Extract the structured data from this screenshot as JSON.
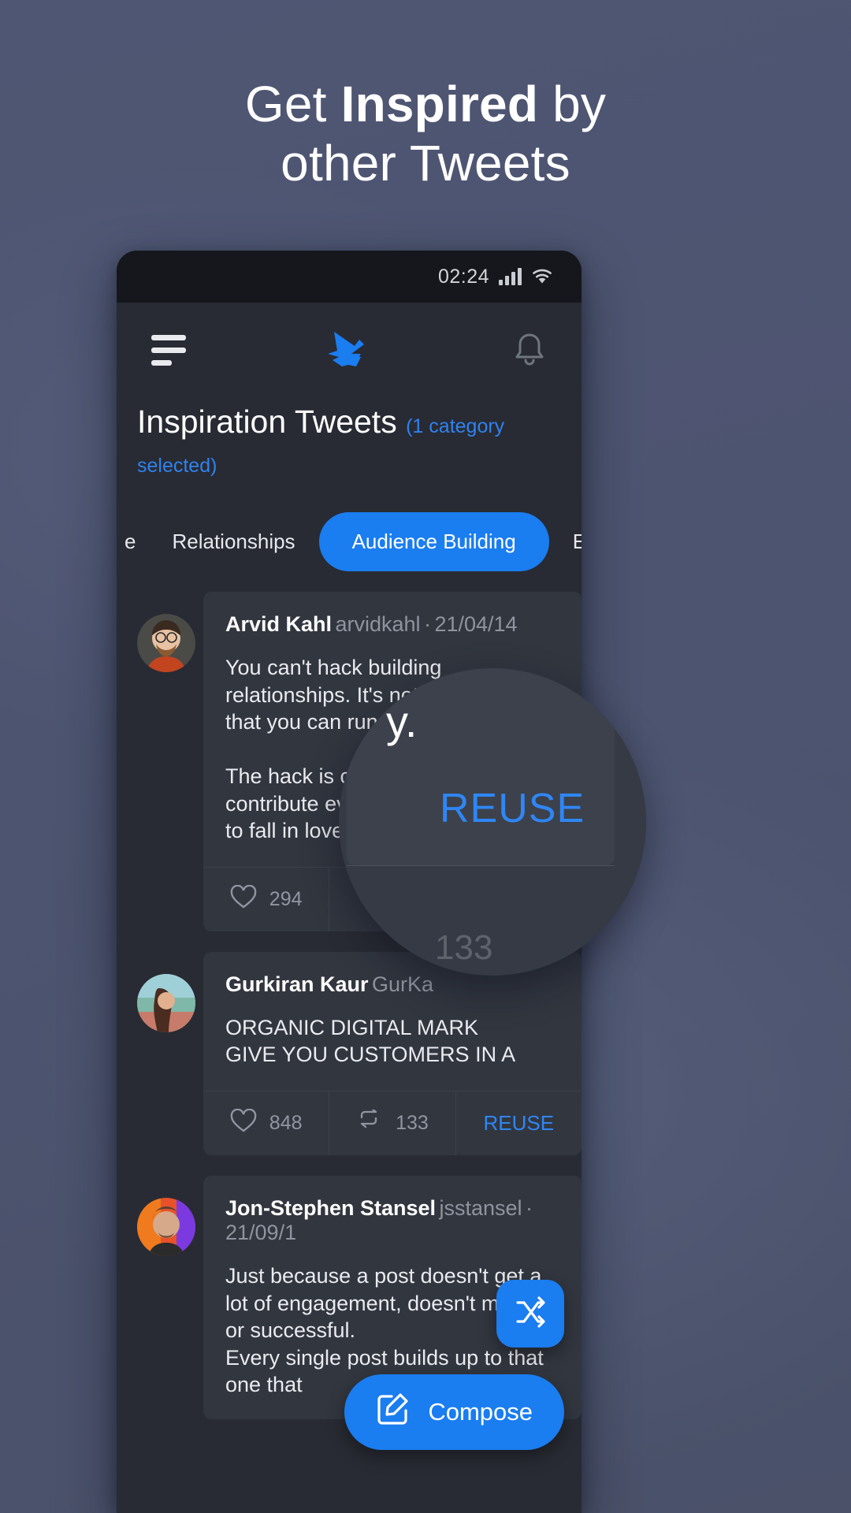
{
  "hero": {
    "line1_pre": "Get ",
    "line1_bold": "Inspired",
    "line1_post": " by",
    "line2": "other Tweets"
  },
  "colors": {
    "background": "#4e5570",
    "accent": "#1a7df0",
    "accent_text": "#2f82f0",
    "phone_screen": "#282b33",
    "card": "#32363f",
    "statusbar": "#15171c"
  },
  "phone": {
    "status_bar": {
      "time": "02:24",
      "signal_icon": "signal-bars-icon",
      "wifi_icon": "wifi-icon"
    },
    "app_bar": {
      "menu_icon": "hamburger-menu-icon",
      "logo_icon": "bird-logo-icon",
      "notifications_icon": "bell-icon"
    },
    "page": {
      "title": "Inspiration Tweets",
      "subtitle": "(1 category selected)"
    },
    "tabs": [
      {
        "label": "e",
        "active": false,
        "partial": true
      },
      {
        "label": "Relationships",
        "active": false
      },
      {
        "label": "Audience Building",
        "active": true
      },
      {
        "label": "Entrepreneurship",
        "active": false
      }
    ],
    "tweets": [
      {
        "name": "Arvid Kahl",
        "handle": "arvidkahl",
        "date": "21/04/14",
        "separator": "·",
        "body": "You can't hack building relationships. It's not like a podcast that you can run at 2x speed.\n\nThe hack is consistency.\ncontribute every day\nto fall in love with",
        "likes": "294",
        "retweets": "",
        "reuse_label": "REUSE",
        "like_icon": "heart-icon",
        "retweet_icon": "retweet-icon"
      },
      {
        "name": "Gurkiran Kaur",
        "handle": "GurKa",
        "date": "",
        "separator": "",
        "body": "ORGANIC DIGITAL MARK\nGIVE YOU CUSTOMERS IN A",
        "likes": "848",
        "retweets": "133",
        "reuse_label": "REUSE",
        "like_icon": "heart-icon",
        "retweet_icon": "retweet-icon"
      },
      {
        "name": "Jon-Stephen Stansel",
        "handle": "jsstansel",
        "date": "21/09/1",
        "separator": "·",
        "body": "Just because a post doesn't get a lot of engagement, doesn't m\nor successful.\nEvery single post builds up to that one that",
        "likes": "",
        "retweets": "",
        "reuse_label": "",
        "like_icon": "heart-icon",
        "retweet_icon": "retweet-icon"
      }
    ],
    "floating_buttons": {
      "shuffle_icon": "shuffle-icon",
      "compose_label": "Compose",
      "compose_icon": "compose-pencil-icon"
    }
  },
  "magnifier": {
    "fragment_text": "y.",
    "reuse_label": "REUSE",
    "retweet_count": "133"
  }
}
